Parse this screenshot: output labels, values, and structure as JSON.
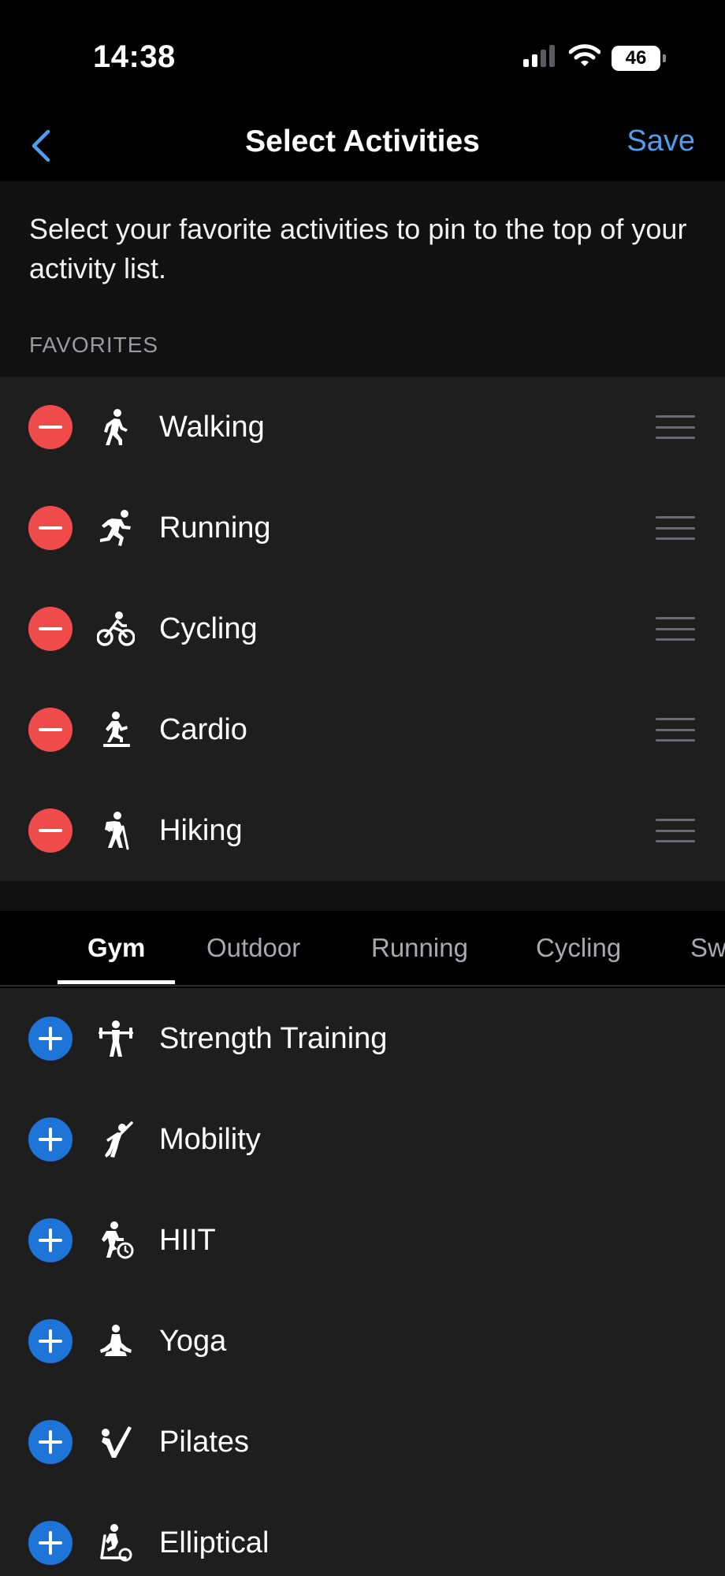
{
  "status": {
    "time": "14:38",
    "battery": "46"
  },
  "nav": {
    "title": "Select Activities",
    "save_label": "Save"
  },
  "intro": {
    "text": "Select your favorite activities to pin to the top of your activity list.",
    "favorites_header": "FAVORITES"
  },
  "favorites": [
    {
      "label": "Walking",
      "icon": "walking-icon"
    },
    {
      "label": "Running",
      "icon": "running-icon"
    },
    {
      "label": "Cycling",
      "icon": "cycling-icon"
    },
    {
      "label": "Cardio",
      "icon": "cardio-icon"
    },
    {
      "label": "Hiking",
      "icon": "hiking-icon"
    }
  ],
  "tabs": [
    {
      "label": "Gym",
      "active": true
    },
    {
      "label": "Outdoor",
      "active": false
    },
    {
      "label": "Running",
      "active": false
    },
    {
      "label": "Cycling",
      "active": false
    },
    {
      "label": "Sw",
      "active": false
    }
  ],
  "gym_activities": [
    {
      "label": "Strength Training",
      "icon": "strength-training-icon"
    },
    {
      "label": "Mobility",
      "icon": "mobility-icon"
    },
    {
      "label": "HIIT",
      "icon": "hiit-icon"
    },
    {
      "label": "Yoga",
      "icon": "yoga-icon"
    },
    {
      "label": "Pilates",
      "icon": "pilates-icon"
    },
    {
      "label": "Elliptical",
      "icon": "elliptical-icon"
    }
  ],
  "colors": {
    "accent": "#4d9ef0",
    "remove": "#ef4b4b",
    "add": "#1f74d7",
    "row_bg": "#1e1e1f"
  }
}
